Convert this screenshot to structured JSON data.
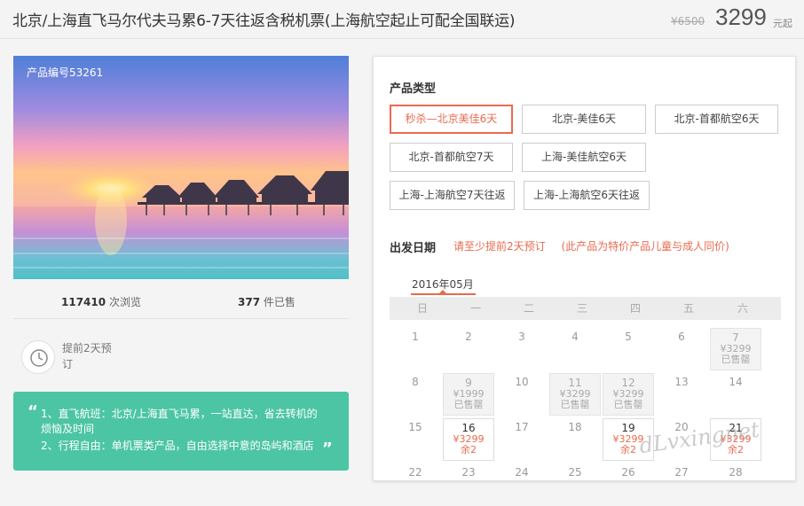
{
  "header": {
    "title": "北京/上海直飞马尔代夫马累6-7天往返含税机票(上海航空起止可配全国联运)",
    "original_price": "¥6500",
    "price": "3299",
    "price_suffix": "元起"
  },
  "hero": {
    "product_id": "产品编号53261"
  },
  "stats": {
    "views_count": "117410",
    "views_label": "次浏览",
    "sold_count": "377",
    "sold_label": "件已售"
  },
  "advance": {
    "text": "提前2天预订",
    "icon": "clock-icon"
  },
  "features": {
    "quote_open": "“",
    "quote_close": "”",
    "lines": [
      "1、直飞航班：北京/上海直飞马累，一站直达，省去转机的",
      "烦恼及时间",
      "2、行程自由：单机票类产品，自由选择中意的岛屿和酒店"
    ]
  },
  "product_type": {
    "label": "产品类型",
    "options": [
      {
        "label": "秒杀—北京美佳6天",
        "selected": true
      },
      {
        "label": "北京-美佳6天",
        "selected": false
      },
      {
        "label": "北京-首都航空6天",
        "selected": false
      },
      {
        "label": "北京-首都航空7天",
        "selected": false
      },
      {
        "label": "上海-美佳航空6天",
        "selected": false
      },
      {
        "label": "上海-上海航空7天往返",
        "selected": false
      },
      {
        "label": "上海-上海航空6天往返",
        "selected": false
      }
    ]
  },
  "departure": {
    "label": "出发日期",
    "hint1": "请至少提前2天预订",
    "hint2": "(此产品为特价产品儿童与成人同价)",
    "month": "2016年05月",
    "weekdays": [
      "日",
      "一",
      "二",
      "三",
      "四",
      "五",
      "六"
    ],
    "days": [
      {
        "num": "1"
      },
      {
        "num": "2"
      },
      {
        "num": "3"
      },
      {
        "num": "4"
      },
      {
        "num": "5"
      },
      {
        "num": "6"
      },
      {
        "num": "7",
        "price": "¥3299",
        "status": "已售罄"
      },
      {
        "num": "8"
      },
      {
        "num": "9",
        "price": "¥1999",
        "status": "已售罄"
      },
      {
        "num": "10"
      },
      {
        "num": "11",
        "price": "¥3299",
        "status": "已售罄"
      },
      {
        "num": "12",
        "price": "¥3299",
        "status": "已售罄"
      },
      {
        "num": "13"
      },
      {
        "num": "14"
      },
      {
        "num": "15"
      },
      {
        "num": "16",
        "price": "¥3299",
        "status": "余2"
      },
      {
        "num": "17"
      },
      {
        "num": "18"
      },
      {
        "num": "19",
        "price": "¥3299",
        "status": "余2"
      },
      {
        "num": "20"
      },
      {
        "num": "21",
        "price": "¥3299",
        "status": "余2"
      },
      {
        "num": "22"
      },
      {
        "num": "23"
      },
      {
        "num": "24"
      },
      {
        "num": "25"
      },
      {
        "num": "26"
      },
      {
        "num": "27"
      },
      {
        "num": "28"
      }
    ]
  },
  "watermark": "dLvxingnet"
}
